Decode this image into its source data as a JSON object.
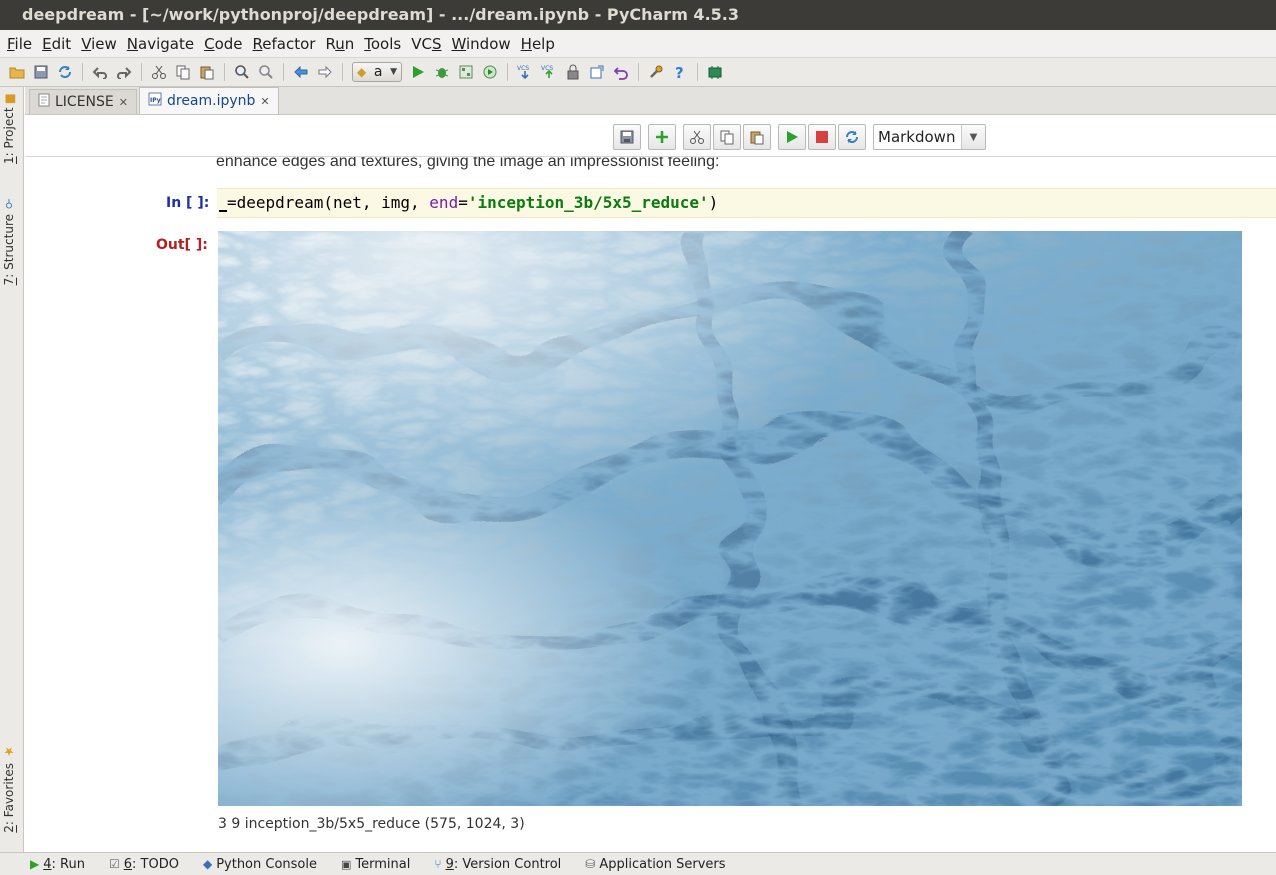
{
  "window": {
    "title": "deepdream - [~/work/pythonproj/deepdream] - .../dream.ipynb - PyCharm 4.5.3"
  },
  "menu": [
    {
      "mn": "F",
      "rest": "ile"
    },
    {
      "mn": "E",
      "rest": "dit"
    },
    {
      "mn": "V",
      "rest": "iew"
    },
    {
      "mn": "N",
      "rest": "avigate"
    },
    {
      "mn": "C",
      "rest": "ode"
    },
    {
      "mn": "R",
      "rest": "efactor"
    },
    {
      "pre": "R",
      "mn": "u",
      "rest": "n"
    },
    {
      "mn": "T",
      "rest": "ools"
    },
    {
      "pre": "VC",
      "mn": "S",
      "rest": ""
    },
    {
      "mn": "W",
      "rest": "indow"
    },
    {
      "mn": "H",
      "rest": "elp"
    }
  ],
  "toolbar": {
    "run_config": "a"
  },
  "side_tabs": {
    "project": {
      "mn": "1",
      "rest": ": Project"
    },
    "structure": {
      "mn": "7",
      "rest": ": Structure"
    },
    "favorites": {
      "mn": "2",
      "rest": ": Favorites"
    }
  },
  "editor_tabs": [
    {
      "label": "LICENSE",
      "active": false
    },
    {
      "label": "dream.ipynb",
      "active": true
    }
  ],
  "notebook": {
    "cell_type": "Markdown",
    "markdown_text": "enhance edges and textures, giving the image an impressionist feeling:",
    "in_prompt": "In [ ]:",
    "out_prompt": "Out[ ]:",
    "code": {
      "prefix": "=deepdream(net, img, ",
      "kw": "end",
      "eq": "=",
      "str": "'inception_3b/5x5_reduce'",
      "suffix": ")"
    },
    "output_caption": "3 9 inception_3b/5x5_reduce (575, 1024, 3)"
  },
  "status_bar": [
    {
      "mn": "4",
      "rest": ": Run"
    },
    {
      "mn": "6",
      "rest": ": TODO"
    },
    {
      "mn": "",
      "rest": "Python Console"
    },
    {
      "mn": "",
      "rest": "Terminal"
    },
    {
      "mn": "9",
      "rest": ": Version Control"
    },
    {
      "mn": "",
      "rest": "Application Servers"
    }
  ],
  "colors": {
    "titlebar": "#3c3b37",
    "in_prompt": "#1f2fa8",
    "out_prompt": "#b22222",
    "code_bg": "#fbf8e4",
    "string": "#0b7b12",
    "keyword_arg": "#7a1ea1"
  }
}
